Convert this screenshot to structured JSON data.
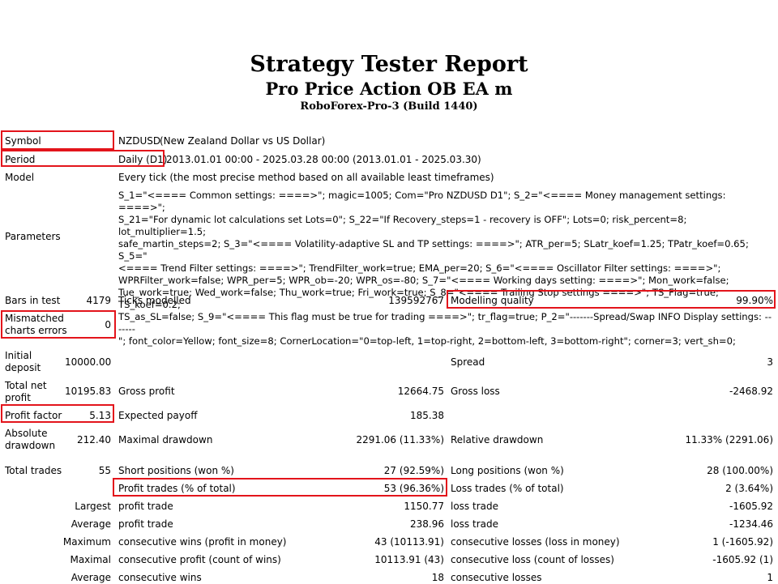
{
  "header": {
    "title": "Strategy Tester Report",
    "ea_name": "Pro Price Action OB EA m",
    "server": "RoboForex-Pro-3 (Build 1440)"
  },
  "info": {
    "symbol_label": "Symbol",
    "symbol_code": "NZDUSD",
    "symbol_desc": "(New Zealand Dollar vs US Dollar)",
    "period_label": "Period",
    "period_value": "Daily (D1)",
    "period_range": "2013.01.01 00:00 - 2025.03.28 00:00 (2013.01.01 - 2025.03.30)",
    "model_label": "Model",
    "model_value": "Every tick (the most precise method based on all available least timeframes)",
    "parameters_label": "Parameters",
    "parameters_value": "S_1=\"<==== Common settings: ====>\"; magic=1005; Com=\"Pro NZDUSD D1\"; S_2=\"<==== Money management settings: ====>\";\nS_21=\"For dynamic lot calculations set Lots=0\"; S_22=\"If Recovery_steps=1 - recovery is OFF\"; Lots=0; risk_percent=8; lot_multiplier=1.5;\nsafe_martin_steps=2; S_3=\"<==== Volatility-adaptive SL and TP settings: ====>\"; ATR_per=5; SLatr_koef=1.25; TPatr_koef=0.65; S_5=\"\n<==== Trend Filter settings: ====>\"; TrendFilter_work=true; EMA_per=20; S_6=\"<==== Oscillator Filter settings: ====>\";\nWPRFilter_work=false; WPR_per=5; WPR_ob=-20; WPR_os=-80; S_7=\"<==== Working days setting: ====>\"; Mon_work=false;\nTue_work=true; Wed_work=false; Thu_work=true; Fri_work=true; S_8=\"<==== Trailing Stop settings ====>\"; TS_Flag=true; TS_koef=0.2;\nTS_as_SL=false; S_9=\"<==== This flag must be true for trading ====>\"; tr_flag=true; P_2=\"-------Spread/Swap INFO Display settings: -------\n\"; font_color=Yellow; font_size=8; CornerLocation=\"0=top-left, 1=top-right, 2=bottom-left, 3=bottom-right\"; corner=3; vert_sh=0;"
  },
  "stats": {
    "bars_label": "Bars in test",
    "bars_value": "4179",
    "ticks_label": "Ticks modelled",
    "ticks_value": "139592767",
    "quality_label": "Modelling quality",
    "quality_value": "99.90%",
    "mismatch_label_1": "Mismatched",
    "mismatch_label_2": "charts errors",
    "mismatch_value": "0",
    "initial_label_1": "Initial",
    "initial_label_2": "deposit",
    "initial_value": "10000.00",
    "spread_label": "Spread",
    "spread_value": "3",
    "net_label_1": "Total net",
    "net_label_2": "profit",
    "net_value": "10195.83",
    "gross_profit_label": "Gross profit",
    "gross_profit_value": "12664.75",
    "gross_loss_label": "Gross loss",
    "gross_loss_value": "-2468.92",
    "pf_label": "Profit factor",
    "pf_value": "5.13",
    "payoff_label": "Expected payoff",
    "payoff_value": "185.38",
    "absdd_label_1": "Absolute",
    "absdd_label_2": "drawdown",
    "absdd_value": "212.40",
    "maxdd_label": "Maximal drawdown",
    "maxdd_value": "2291.06 (11.33%)",
    "reldd_label": "Relative drawdown",
    "reldd_value": "11.33% (2291.06)",
    "trades_label": "Total trades",
    "trades_value": "55",
    "short_label": "Short positions (won %)",
    "short_value": "27 (92.59%)",
    "long_label": "Long positions (won %)",
    "long_value": "28 (100.00%)",
    "profit_trades_label": "Profit trades (% of total)",
    "profit_trades_value": "53 (96.36%)",
    "loss_trades_label": "Loss trades (% of total)",
    "loss_trades_value": "2 (3.64%)",
    "largest_label": "Largest",
    "largest_profit_label": "profit trade",
    "largest_profit_value": "1150.77",
    "largest_loss_label": "loss trade",
    "largest_loss_value": "-1605.92",
    "average_label": "Average",
    "average_profit_label": "profit trade",
    "average_profit_value": "238.96",
    "average_loss_label": "loss trade",
    "average_loss_value": "-1234.46",
    "maximum_label": "Maximum",
    "max_wins_label": "consecutive wins (profit in money)",
    "max_wins_value": "43 (10113.91)",
    "max_losses_label": "consecutive losses (loss in money)",
    "max_losses_value": "1 (-1605.92)",
    "maximal_label": "Maximal",
    "maximal_profit_label": "consecutive profit (count of wins)",
    "maximal_profit_value": "10113.91 (43)",
    "maximal_loss_label": "consecutive loss (count of losses)",
    "maximal_loss_value": "-1605.92 (1)",
    "avg_cons_label": "Average",
    "avg_cons_wins_label": "consecutive wins",
    "avg_cons_wins_value": "18",
    "avg_cons_losses_label": "consecutive losses",
    "avg_cons_losses_value": "1"
  },
  "colors": {
    "highlight": "#e3141b"
  }
}
